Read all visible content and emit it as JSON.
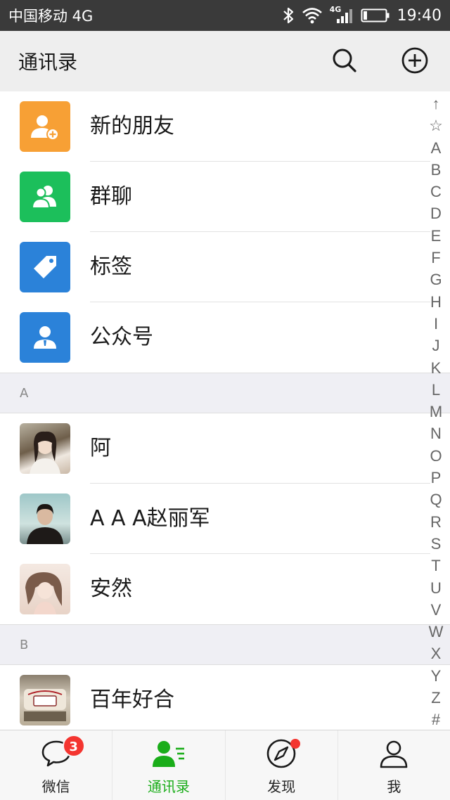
{
  "status_bar": {
    "carrier": "中国移动 4G",
    "network_label": "4G",
    "time": "19:40"
  },
  "header": {
    "title": "通讯录",
    "search_icon": "search-icon",
    "add_icon": "plus-circle-icon"
  },
  "functions": [
    {
      "label": "新的朋友",
      "icon": "add-friend-icon",
      "color": "#f7a035"
    },
    {
      "label": "群聊",
      "icon": "group-chat-icon",
      "color": "#1cbf5b"
    },
    {
      "label": "标签",
      "icon": "tag-icon",
      "color": "#2b82d9"
    },
    {
      "label": "公众号",
      "icon": "official-account-icon",
      "color": "#2b82d9"
    }
  ],
  "sections": [
    {
      "letter": "A",
      "contacts": [
        "阿",
        "A A A赵丽军",
        "安然"
      ]
    },
    {
      "letter": "B",
      "contacts": [
        "百年好合"
      ]
    }
  ],
  "index_letters": [
    "↑",
    "☆",
    "A",
    "B",
    "C",
    "D",
    "E",
    "F",
    "G",
    "H",
    "I",
    "J",
    "K",
    "L",
    "M",
    "N",
    "O",
    "P",
    "Q",
    "R",
    "S",
    "T",
    "U",
    "V",
    "W",
    "X",
    "Y",
    "Z",
    "#"
  ],
  "tabs": [
    {
      "label": "微信",
      "icon": "chat-bubble-icon",
      "badge": "3"
    },
    {
      "label": "通讯录",
      "icon": "contacts-icon",
      "active": true
    },
    {
      "label": "发现",
      "icon": "compass-icon",
      "dot": true
    },
    {
      "label": "我",
      "icon": "person-icon"
    }
  ],
  "colors": {
    "accent": "#1aad19",
    "badge": "#f43530",
    "status_bar": "#3a3a3a",
    "header": "#eeeeee"
  }
}
